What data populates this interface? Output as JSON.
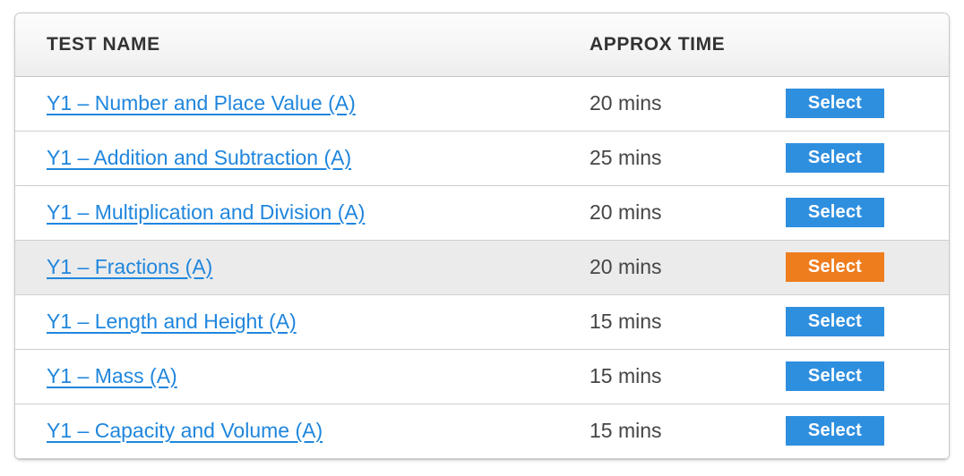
{
  "table": {
    "columns": [
      {
        "key": "test_name",
        "label": "TEST NAME"
      },
      {
        "key": "approx_time",
        "label": "APPROX TIME"
      },
      {
        "key": "action",
        "label": ""
      }
    ],
    "action_label": "Select",
    "rows": [
      {
        "test_name": "Y1 – Number and Place Value (A)",
        "approx_time": "20 mins",
        "action_label": "Select",
        "highlighted": false,
        "action_state": "default"
      },
      {
        "test_name": "Y1 – Addition and Subtraction (A)",
        "approx_time": "25 mins",
        "action_label": "Select",
        "highlighted": false,
        "action_state": "default"
      },
      {
        "test_name": "Y1 – Multiplication and Division (A)",
        "approx_time": "20 mins",
        "action_label": "Select",
        "highlighted": false,
        "action_state": "default"
      },
      {
        "test_name": "Y1 – Fractions (A)",
        "approx_time": "20 mins",
        "action_label": "Select",
        "highlighted": true,
        "action_state": "active"
      },
      {
        "test_name": "Y1 – Length and Height (A)",
        "approx_time": "15 mins",
        "action_label": "Select",
        "highlighted": false,
        "action_state": "default"
      },
      {
        "test_name": "Y1 – Mass (A)",
        "approx_time": "15 mins",
        "action_label": "Select",
        "highlighted": false,
        "action_state": "default"
      },
      {
        "test_name": "Y1 – Capacity and Volume (A)",
        "approx_time": "15 mins",
        "action_label": "Select",
        "highlighted": false,
        "action_state": "default"
      }
    ]
  },
  "colors": {
    "link": "#2086dd",
    "button_default": "#2f8fdf",
    "button_active": "#ee7d1e",
    "header_text": "#333333",
    "time_text": "#454545",
    "row_highlight": "#ebebeb",
    "row_border": "#cfcfcf",
    "panel_border": "#c9c9c9"
  }
}
